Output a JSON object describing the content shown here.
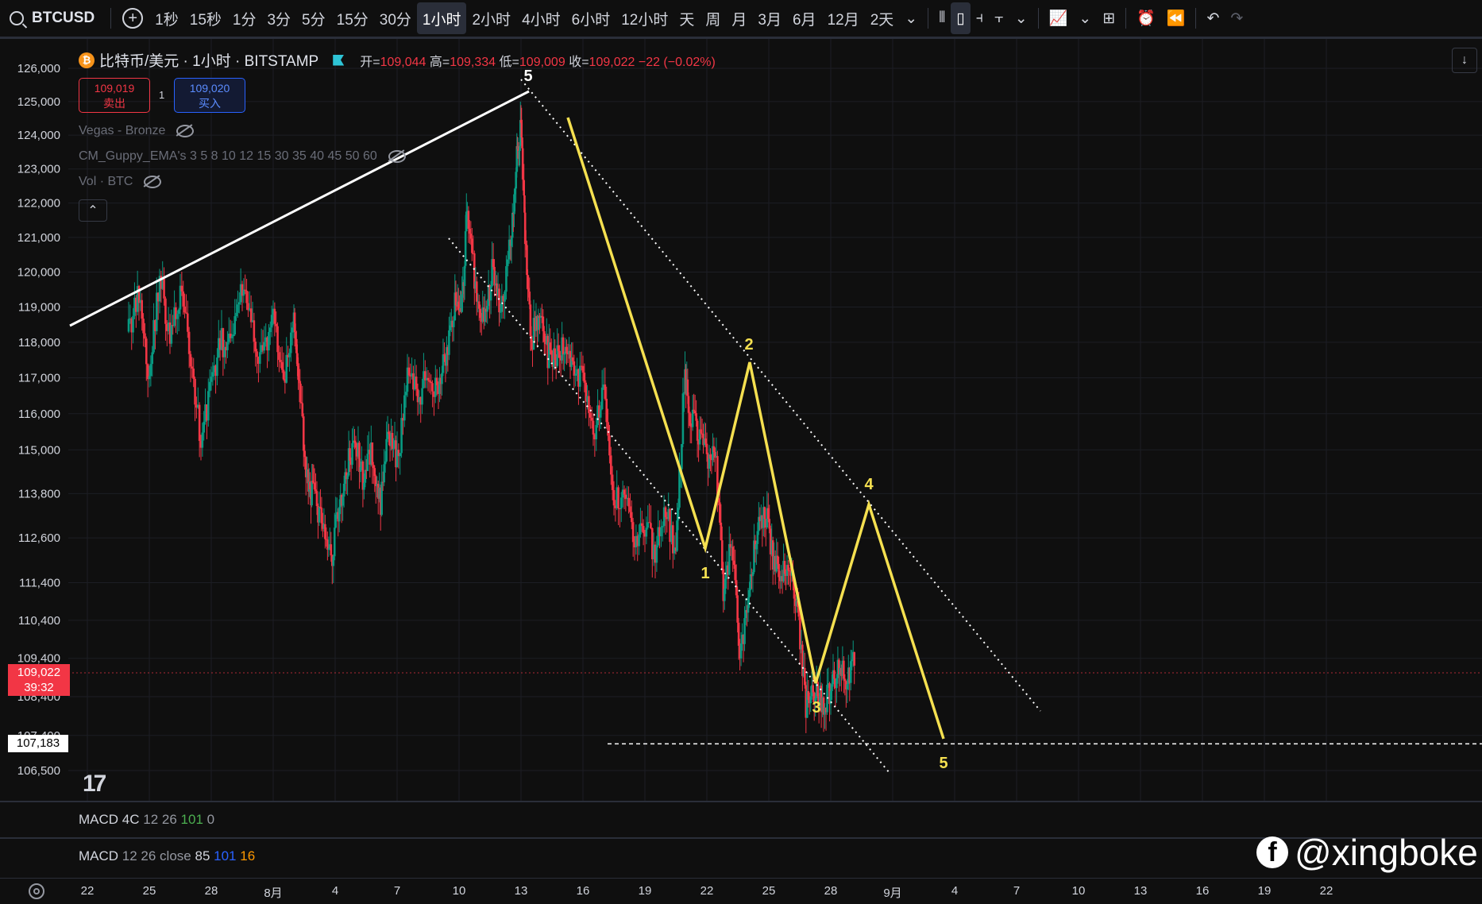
{
  "toolbar": {
    "symbol": "BTCUSD",
    "intervals": [
      "1秒",
      "15秒",
      "1分",
      "3分",
      "5分",
      "15分",
      "30分",
      "1小时",
      "2小时",
      "4小时",
      "6小时",
      "12小时",
      "天",
      "周",
      "月",
      "3月",
      "6月",
      "12月",
      "2天"
    ],
    "active_interval": "1小时"
  },
  "legend": {
    "coin_glyph": "₿",
    "title": "比特币/美元 · 1小时 · BITSTAMP",
    "open_label": "开=",
    "open": "109,044",
    "high_label": "高=",
    "high": "109,334",
    "low_label": "低=",
    "low": "109,009",
    "close_label": "收=",
    "close": "109,022",
    "change": "−22 (−0.02%)"
  },
  "trade": {
    "sell_price": "109,019",
    "sell_label": "卖出",
    "spread": "1",
    "buy_price": "109,020",
    "buy_label": "买入"
  },
  "indicators": [
    {
      "label": "Vegas - Bronze"
    },
    {
      "label": "CM_Guppy_EMA's 3 5 8 10 12 15 30 35 40 45 50 60"
    },
    {
      "label": "Vol · BTC"
    }
  ],
  "price_tag": {
    "price": "109,022",
    "countdown": "39:32"
  },
  "low_tag": "107,183",
  "macd1": {
    "name": "MACD 4C",
    "params": "12 26",
    "v1": "101",
    "v2": "0"
  },
  "macd2": {
    "name": "MACD",
    "params": "12 26 close",
    "v1": "85",
    "v2": "101",
    "v3": "16"
  },
  "watermark": {
    "fb": "f",
    "handle": "@xingboke"
  },
  "colors": {
    "up": "#089981",
    "down": "#f23645",
    "wave": "#f5e050",
    "background": "#0f0f0f"
  },
  "chart_data": {
    "type": "candlestick",
    "price_axis_labels": [
      "126,000",
      "125,000",
      "124,000",
      "123,000",
      "122,000",
      "121,000",
      "120,000",
      "119,000",
      "118,000",
      "117,000",
      "116,000",
      "115,000",
      "113,800",
      "112,600",
      "111,400",
      "110,400",
      "109,400",
      "108,400",
      "107,400",
      "106,500"
    ],
    "time_axis_labels": [
      "22",
      "25",
      "28",
      "8月",
      "4",
      "7",
      "10",
      "13",
      "16",
      "19",
      "22",
      "25",
      "28",
      "9月",
      "4",
      "7",
      "10",
      "13",
      "16",
      "19",
      "22"
    ],
    "wave_labels": [
      "5",
      "1",
      "2",
      "3",
      "4",
      "5"
    ],
    "wave_points": [
      [
        14,
        124500
      ],
      [
        20,
        112300
      ],
      [
        22.8,
        117400
      ],
      [
        26.5,
        108900
      ],
      [
        28.6,
        113600
      ],
      [
        31.3,
        107183
      ]
    ],
    "price_series": [
      [
        -8,
        118300
      ],
      [
        -7.5,
        119500
      ],
      [
        -7,
        117000
      ],
      [
        -6.5,
        120000
      ],
      [
        -6,
        118000
      ],
      [
        -5.5,
        119500
      ],
      [
        -5,
        117600
      ],
      [
        -4.5,
        115200
      ],
      [
        -4,
        117000
      ],
      [
        -3.5,
        118000
      ],
      [
        -3,
        117900
      ],
      [
        -2.5,
        119600
      ],
      [
        -2,
        118200
      ],
      [
        -1.5,
        117500
      ],
      [
        -1,
        119000
      ],
      [
        -0.5,
        116600
      ],
      [
        0,
        118900
      ],
      [
        0.3,
        116200
      ],
      [
        0.7,
        114000
      ],
      [
        1,
        113700
      ],
      [
        1.4,
        112800
      ],
      [
        1.8,
        112000
      ],
      [
        2.2,
        113500
      ],
      [
        2.6,
        114600
      ],
      [
        3,
        115200
      ],
      [
        3.4,
        114100
      ],
      [
        3.8,
        115000
      ],
      [
        4.2,
        113500
      ],
      [
        4.6,
        115500
      ],
      [
        5,
        114600
      ],
      [
        5.5,
        117100
      ],
      [
        6,
        116500
      ],
      [
        6.5,
        117000
      ],
      [
        7,
        116800
      ],
      [
        7.4,
        117800
      ],
      [
        7.8,
        119000
      ],
      [
        8.1,
        118500
      ],
      [
        8.4,
        121800
      ],
      [
        8.8,
        119500
      ],
      [
        9.2,
        118500
      ],
      [
        9.6,
        120000
      ],
      [
        10,
        118900
      ],
      [
        10.5,
        121000
      ],
      [
        10.8,
        123500
      ],
      [
        11,
        124100
      ],
      [
        11.2,
        121000
      ],
      [
        11.5,
        118000
      ],
      [
        11.9,
        119000
      ],
      [
        12.3,
        117600
      ],
      [
        12.7,
        117500
      ],
      [
        13.1,
        118000
      ],
      [
        13.5,
        117200
      ],
      [
        14,
        117100
      ],
      [
        14.5,
        115500
      ],
      [
        15,
        116500
      ],
      [
        15.5,
        113500
      ],
      [
        16,
        114000
      ],
      [
        16.5,
        112500
      ],
      [
        17,
        112900
      ],
      [
        17.5,
        112200
      ],
      [
        18,
        113500
      ],
      [
        18.5,
        112000
      ],
      [
        18.9,
        117000
      ],
      [
        19.2,
        116000
      ],
      [
        19.6,
        115500
      ],
      [
        20,
        114800
      ],
      [
        20.4,
        115000
      ],
      [
        20.8,
        111000
      ],
      [
        21.2,
        112500
      ],
      [
        21.6,
        109500
      ],
      [
        22,
        111000
      ],
      [
        22.4,
        112700
      ],
      [
        22.8,
        113500
      ],
      [
        23.2,
        112000
      ],
      [
        23.6,
        111500
      ],
      [
        24,
        112000
      ],
      [
        24.4,
        110600
      ],
      [
        24.8,
        108100
      ],
      [
        25.2,
        108600
      ],
      [
        25.6,
        108200
      ],
      [
        26,
        108600
      ],
      [
        26.4,
        109300
      ],
      [
        26.8,
        108900
      ],
      [
        27.2,
        109700
      ]
    ]
  }
}
